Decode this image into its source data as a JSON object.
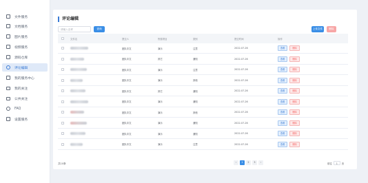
{
  "sidebar": {
    "items": [
      {
        "label": "文件服务",
        "icon": "file-icon"
      },
      {
        "label": "文档服务",
        "icon": "folder-icon"
      },
      {
        "label": "图片服务",
        "icon": "image-icon"
      },
      {
        "label": "视频服务",
        "icon": "video-icon"
      },
      {
        "label": "源码仓库",
        "icon": "repo-icon"
      },
      {
        "label": "评论编辑",
        "icon": "comment-icon"
      },
      {
        "label": "我的服务中心",
        "icon": "service-icon"
      },
      {
        "label": "我的关注",
        "icon": "monitor-icon"
      },
      {
        "label": "公共关注",
        "icon": "monitor-icon"
      },
      {
        "label": "FAQ",
        "icon": "question-icon"
      },
      {
        "label": "设置服务",
        "icon": "settings-icon"
      }
    ]
  },
  "page": {
    "title": "评论编辑",
    "search_placeholder": "请输入名称",
    "search_label": "查询",
    "upload_label": "上传文件",
    "delete_label": "删除"
  },
  "table": {
    "headers": [
      "文件名",
      "提交人",
      "所属项目",
      "类别",
      "提交时间",
      "操作"
    ],
    "rows": [
      {
        "submitter": "团队中文",
        "project": "演示",
        "category": "注意",
        "time": "2022-07-26",
        "pink": false
      },
      {
        "submitter": "团队中文",
        "project": "其它",
        "category": "通知",
        "time": "2022-07-26",
        "pink": false
      },
      {
        "submitter": "团队中文",
        "project": "演示",
        "category": "注意",
        "time": "2022-07-26",
        "pink": false
      },
      {
        "submitter": "团队中文",
        "project": "演示",
        "category": "其他",
        "time": "2022-07-26",
        "pink": false
      },
      {
        "submitter": "团队中文",
        "project": "其它",
        "category": "通知",
        "time": "2022-07-26",
        "pink": false
      },
      {
        "submitter": "团队中文",
        "project": "演示",
        "category": "通知",
        "time": "2022-07-26",
        "pink": false
      },
      {
        "submitter": "团队中文",
        "project": "演示",
        "category": "其他",
        "time": "2022-07-26",
        "pink": true
      },
      {
        "submitter": "团队中文",
        "project": "演示",
        "category": "通知",
        "time": "2022-07-26",
        "pink": true
      },
      {
        "submitter": "团队中文",
        "project": "演示",
        "category": "通知",
        "time": "2022-07-26",
        "pink": false
      },
      {
        "submitter": "团队中文",
        "project": "演示",
        "category": "注意",
        "time": "2022-07-26",
        "pink": false
      }
    ],
    "view_label": "查看",
    "delete_label": "删除"
  },
  "pagination": {
    "total_text": "共10条",
    "prev": "‹",
    "pages": [
      "1",
      "2",
      "3"
    ],
    "next": "›",
    "goto_label": "前往",
    "goto_value": "1",
    "goto_suffix": "页"
  },
  "colors": {
    "primary": "#3a8ee6",
    "danger": "#f56c6c",
    "active_bg": "#dfe9f8"
  }
}
